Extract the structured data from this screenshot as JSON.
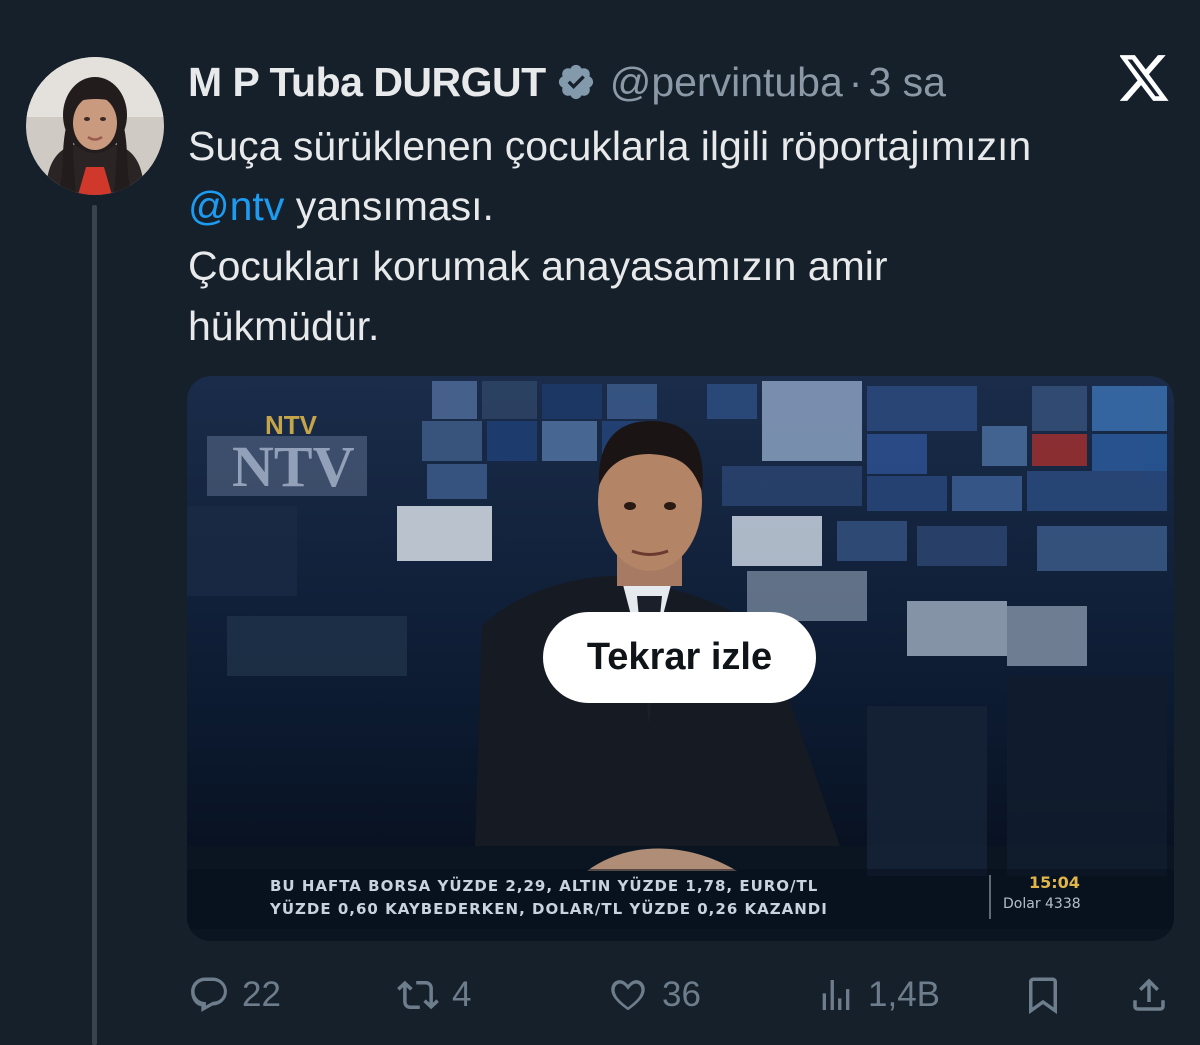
{
  "tweet": {
    "author_name": "M P Tuba DURGUT",
    "handle": "@pervintuba",
    "separator": "·",
    "time": "3 sa",
    "text_line1": "Suça sürüklenen çocuklarla ilgili röportajımızın",
    "mention": "@ntv",
    "text_line2_rest": " yansıması.",
    "text_line3": "Çocukları korumak anayasamızın amir",
    "text_line4": "hükmüdür."
  },
  "media": {
    "replay_label": "Tekrar izle",
    "channel_logo": "NTV",
    "ticker_line1": "BU HAFTA BORSA YÜZDE 2,29, ALTIN YÜZDE 1,78, EURO/TL",
    "ticker_line2": "YÜZDE 0,60 KAYBEDERKEN, DOLAR/TL YÜZDE 0,26 KAZANDI",
    "ticker_time": "15:04",
    "ticker_dolar": "Dolar   4338"
  },
  "actions": {
    "replies": "22",
    "retweets": "4",
    "likes": "36",
    "views": "1,4B"
  },
  "icons": {
    "verified": "verified-badge-icon",
    "x_logo": "x-logo-icon",
    "reply": "reply-icon",
    "retweet": "retweet-icon",
    "like": "heart-icon",
    "views": "views-icon",
    "bookmark": "bookmark-icon",
    "share": "share-icon"
  },
  "colors": {
    "background": "#15202b",
    "link": "#1d9bf0",
    "muted": "#8b98a5",
    "action_gray": "#6e7d8b"
  }
}
